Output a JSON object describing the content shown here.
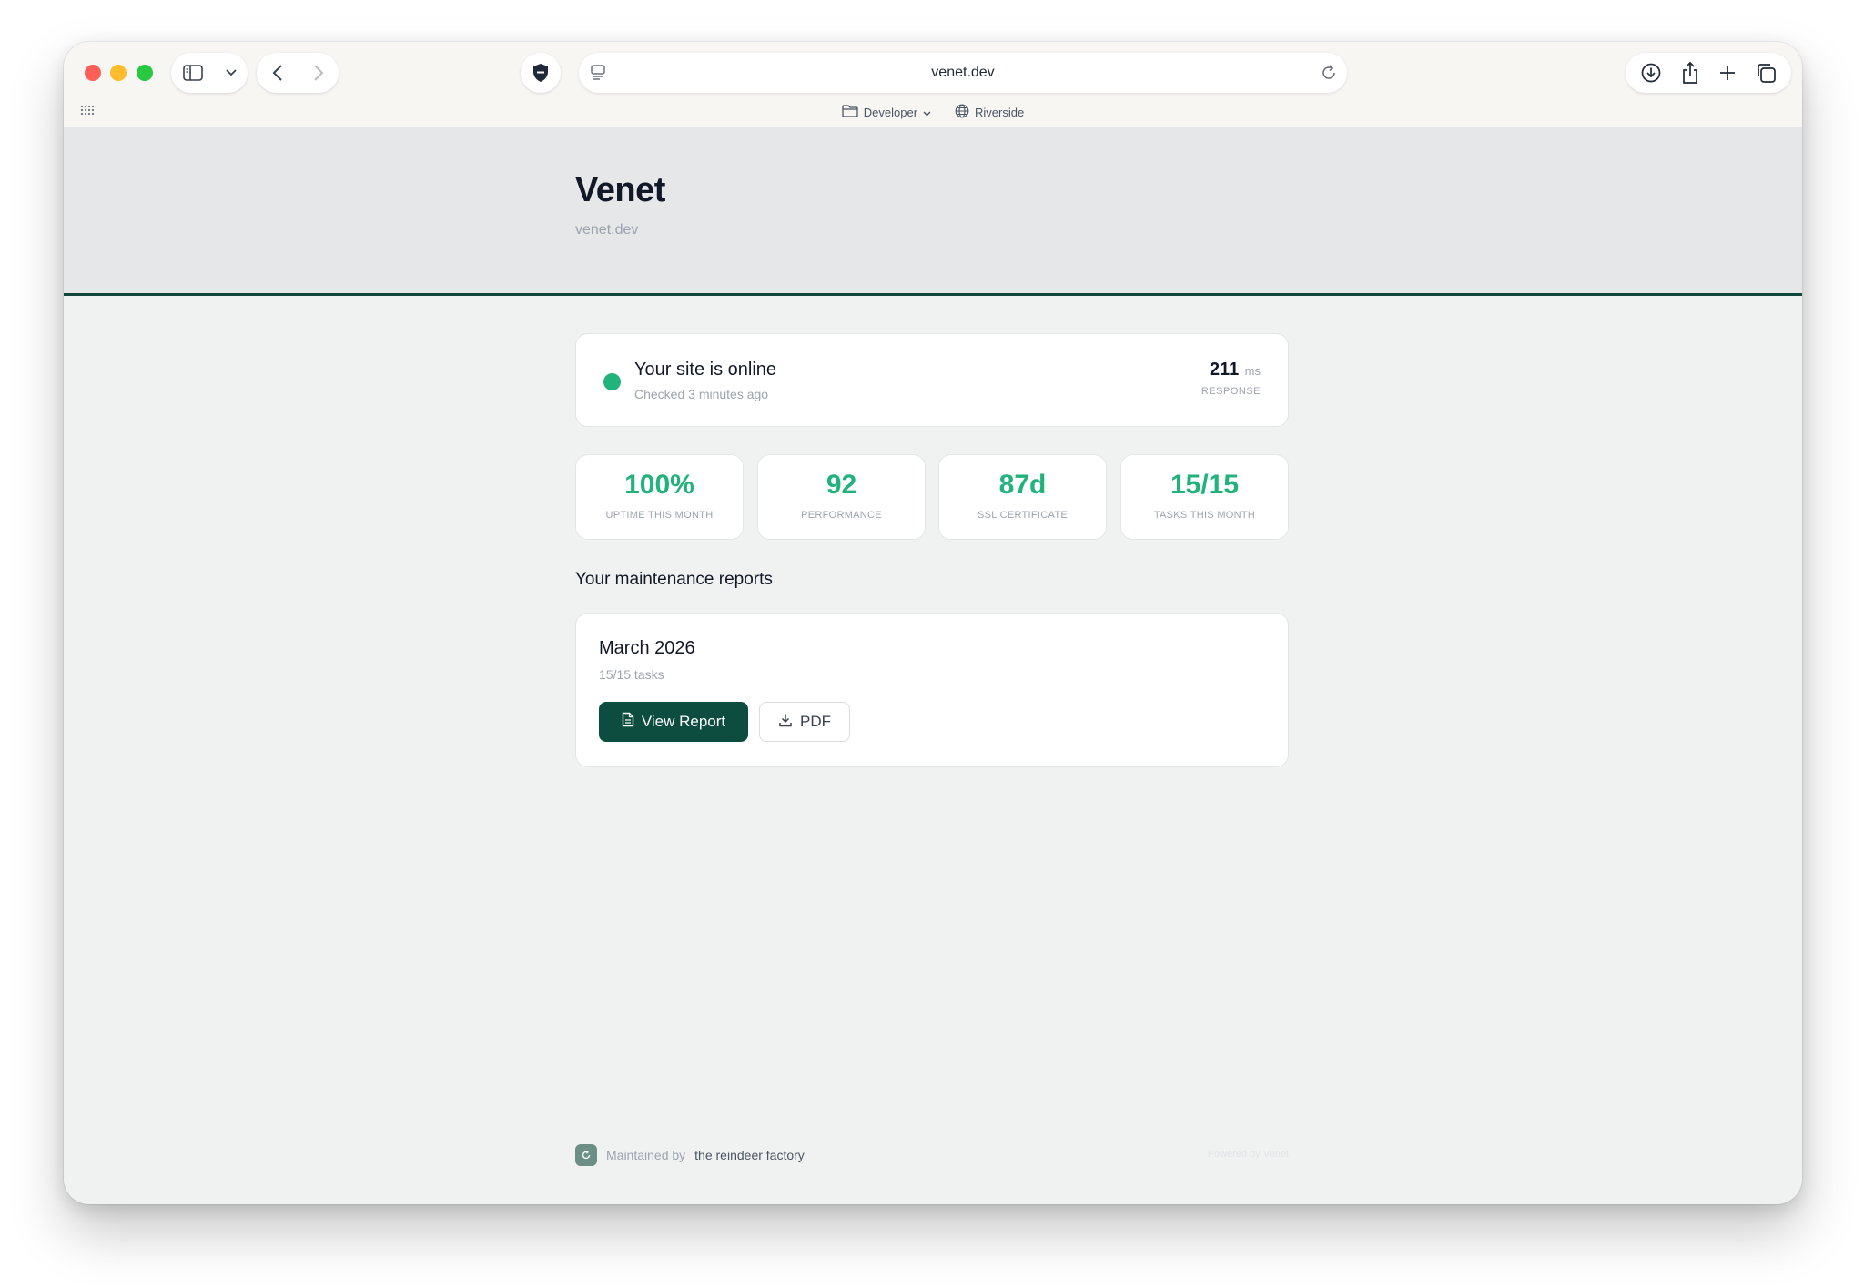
{
  "browser": {
    "url": "venet.dev",
    "bookmarks": [
      {
        "label": "Developer",
        "icon": "folder-icon"
      },
      {
        "label": "Riverside",
        "icon": "globe-icon"
      }
    ]
  },
  "site": {
    "name": "Venet",
    "domain": "venet.dev"
  },
  "status": {
    "title": "Your site is online",
    "checked": "Checked 3 minutes ago",
    "response_value": "211",
    "response_unit": "ms",
    "response_label": "RESPONSE",
    "color": "#22b27c"
  },
  "stats": [
    {
      "value": "100%",
      "label": "UPTIME THIS MONTH"
    },
    {
      "value": "92",
      "label": "PERFORMANCE"
    },
    {
      "value": "87d",
      "label": "SSL CERTIFICATE"
    },
    {
      "value": "15/15",
      "label": "TASKS THIS MONTH"
    }
  ],
  "reports": {
    "heading": "Your maintenance reports",
    "items": [
      {
        "month": "March 2026",
        "tasks": "15/15 tasks",
        "view_label": "View Report",
        "pdf_label": "PDF"
      }
    ]
  },
  "footer": {
    "maintained_prefix": "Maintained by",
    "maintainer": "the reindeer factory",
    "powered": "Powered by Venet"
  },
  "colors": {
    "accent": "#0c4d40",
    "success": "#22b27c"
  }
}
